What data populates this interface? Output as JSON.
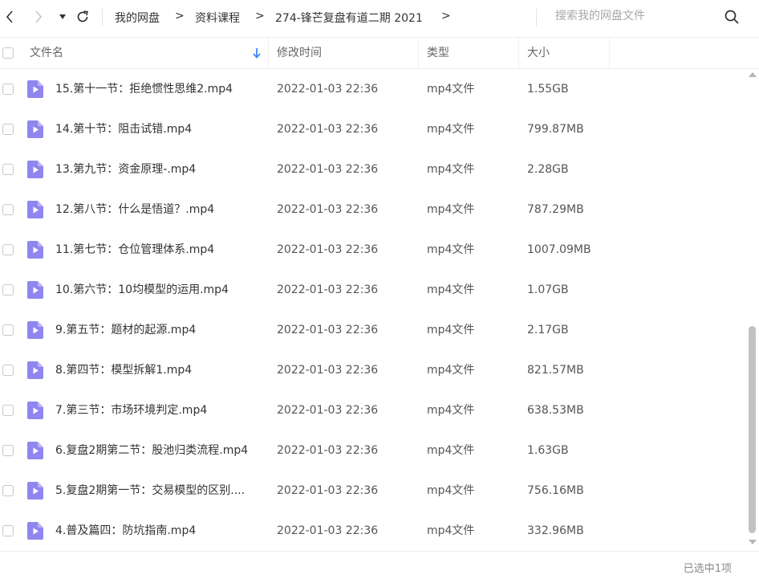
{
  "nav": {
    "back_icon": "chevron-left-icon",
    "forward_icon": "chevron-right-icon",
    "dropdown_icon": "caret-down-icon",
    "refresh_icon": "refresh-icon"
  },
  "breadcrumb": [
    "我的网盘",
    "资料课程",
    "274-锋芒复盘有道二期 2021"
  ],
  "search": {
    "placeholder": "搜索我的网盘文件"
  },
  "columns": {
    "name": "文件名",
    "time": "修改时间",
    "type": "类型",
    "size": "大小"
  },
  "accent_color": "#3d8bff",
  "file_icon_color": "#8f86f0",
  "files": [
    {
      "name": "15.第十一节：拒绝惯性思维2.mp4",
      "time": "2022-01-03 22:36",
      "type": "mp4文件",
      "size": "1.55GB"
    },
    {
      "name": "14.第十节：阻击试错.mp4",
      "time": "2022-01-03 22:36",
      "type": "mp4文件",
      "size": "799.87MB"
    },
    {
      "name": "13.第九节：资金原理-.mp4",
      "time": "2022-01-03 22:36",
      "type": "mp4文件",
      "size": "2.28GB"
    },
    {
      "name": "12.第八节：什么是悟道？.mp4",
      "time": "2022-01-03 22:36",
      "type": "mp4文件",
      "size": "787.29MB"
    },
    {
      "name": "11.第七节：仓位管理体系.mp4",
      "time": "2022-01-03 22:36",
      "type": "mp4文件",
      "size": "1007.09MB"
    },
    {
      "name": "10.第六节：10均模型的运用.mp4",
      "time": "2022-01-03 22:36",
      "type": "mp4文件",
      "size": "1.07GB"
    },
    {
      "name": "9.第五节：题材的起源.mp4",
      "time": "2022-01-03 22:36",
      "type": "mp4文件",
      "size": "2.17GB"
    },
    {
      "name": "8.第四节：模型拆解1.mp4",
      "time": "2022-01-03 22:36",
      "type": "mp4文件",
      "size": "821.57MB"
    },
    {
      "name": "7.第三节：市场环境判定.mp4",
      "time": "2022-01-03 22:36",
      "type": "mp4文件",
      "size": "638.53MB"
    },
    {
      "name": "6.复盘2期第二节：股池归类流程.mp4",
      "time": "2022-01-03 22:36",
      "type": "mp4文件",
      "size": "1.63GB"
    },
    {
      "name": "5.复盘2期第一节：交易模型的区别....",
      "time": "2022-01-03 22:36",
      "type": "mp4文件",
      "size": "756.16MB"
    },
    {
      "name": "4.普及篇四：防坑指南.mp4",
      "time": "2022-01-03 22:36",
      "type": "mp4文件",
      "size": "332.96MB"
    }
  ],
  "status": {
    "selected": "已选中1项"
  }
}
